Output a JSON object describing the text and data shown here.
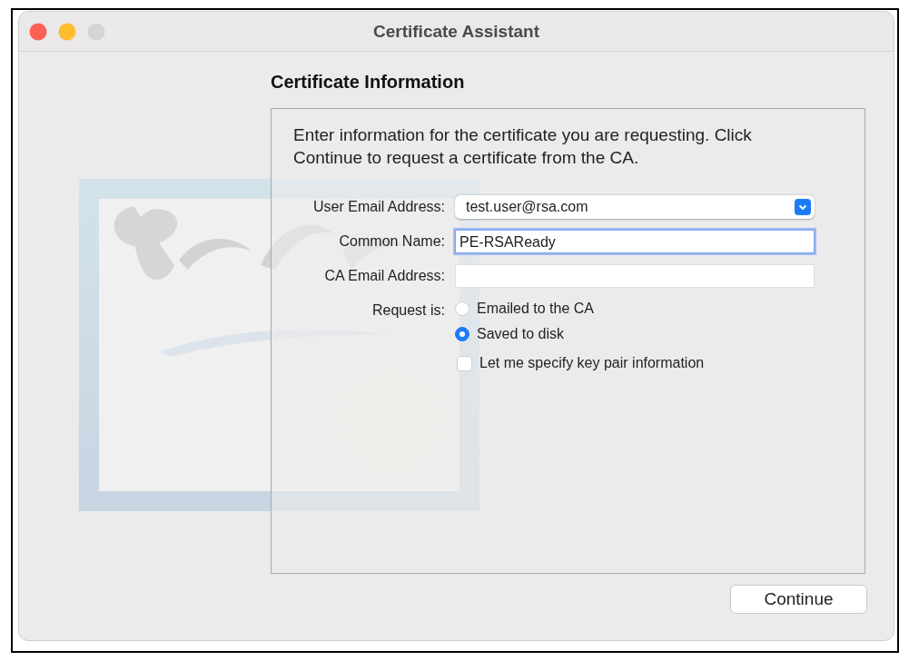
{
  "window": {
    "title": "Certificate Assistant"
  },
  "heading": "Certificate Information",
  "description": "Enter information for the certificate you are requesting. Click Continue to request a certificate from the CA.",
  "fields": [
    {
      "kind": "dropdown",
      "label": "User Email Address:",
      "value": "test.user@rsa.com",
      "focused": false
    },
    {
      "kind": "text",
      "label": "Common Name:",
      "value": "PE-RSAReady",
      "focused": true
    },
    {
      "kind": "text",
      "label": "CA Email Address:",
      "focused": false
    }
  ],
  "request": {
    "label": "Request is:",
    "options": [
      {
        "label": "Emailed to the CA",
        "selected": false
      },
      {
        "label": "Saved to disk",
        "selected": true
      }
    ]
  },
  "checkbox": {
    "label": "Let me specify key pair information",
    "checked": false
  },
  "buttons": [
    {
      "label": "Continue"
    }
  ]
}
